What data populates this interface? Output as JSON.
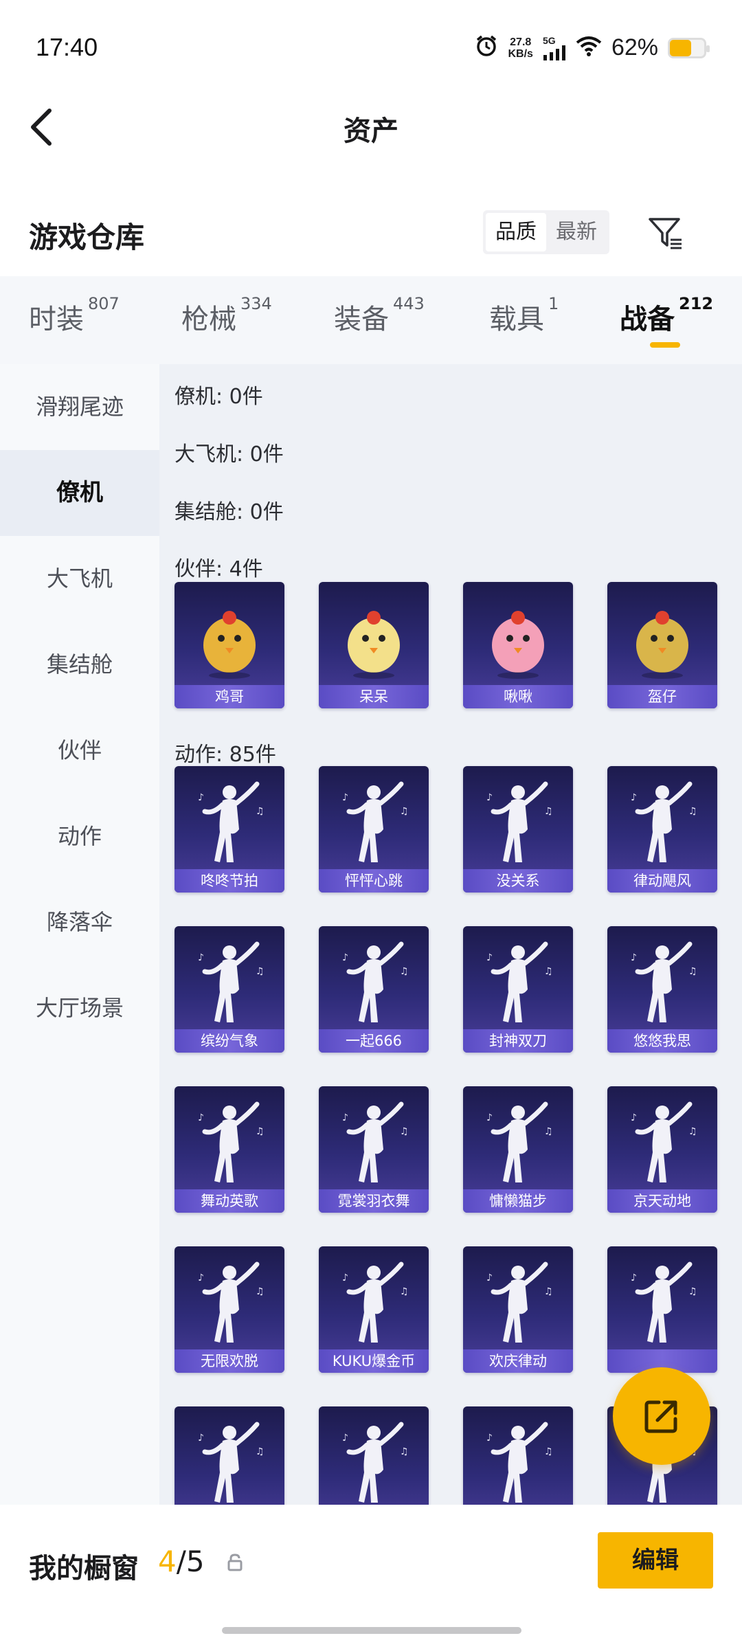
{
  "status_bar": {
    "time": "17:40",
    "speed_value": "27.8",
    "speed_unit": "KB/s",
    "network": "5G",
    "battery_percent": "62%",
    "battery_level": 0.62,
    "icons": [
      "alarm-icon",
      "signal-icon",
      "wifi-icon",
      "battery-icon"
    ]
  },
  "header": {
    "title": "资产",
    "back_icon": "chevron-left-icon"
  },
  "section": {
    "title": "游戏仓库",
    "sort_options": [
      "品质",
      "最新"
    ],
    "sort_selected": "品质",
    "filter_icon": "filter-icon"
  },
  "category_tabs": [
    {
      "label": "时装",
      "count": "807"
    },
    {
      "label": "枪械",
      "count": "334"
    },
    {
      "label": "装备",
      "count": "443"
    },
    {
      "label": "载具",
      "count": "1"
    },
    {
      "label": "战备",
      "count": "212",
      "active": true
    }
  ],
  "sidebar": {
    "items": [
      "滑翔尾迹",
      "僚机",
      "大飞机",
      "集结舱",
      "伙伴",
      "动作",
      "降落伞",
      "大厅场景"
    ],
    "active": "僚机"
  },
  "content": {
    "counts": [
      {
        "label": "僚机: 0件"
      },
      {
        "label": "大飞机: 0件"
      },
      {
        "label": "集结舱: 0件"
      },
      {
        "label": "伙伴: 4件"
      },
      {
        "label": "动作: 85件"
      }
    ],
    "partners": [
      "鸡哥",
      "呆呆",
      "啾啾",
      "盔仔"
    ],
    "actions": [
      "咚咚节拍",
      "怦怦心跳",
      "没关系",
      "律动飓风",
      "缤纷气象",
      "一起666",
      "封神双刀",
      "悠悠我思",
      "舞动英歌",
      "霓裳羽衣舞",
      "慵懒猫步",
      "京天动地",
      "无限欢脱",
      "KUKU爆金币",
      "欢庆律动",
      ""
    ]
  },
  "fab": {
    "icon": "share-icon"
  },
  "bottom_bar": {
    "label": "我的橱窗",
    "count_current": "4",
    "count_total": "/5",
    "lock_icon": "lock-icon",
    "edit_label": "编辑"
  },
  "colors": {
    "accent": "#f7b500",
    "card_bg": "#2e2b78",
    "card_label": "#6a5bd1"
  }
}
